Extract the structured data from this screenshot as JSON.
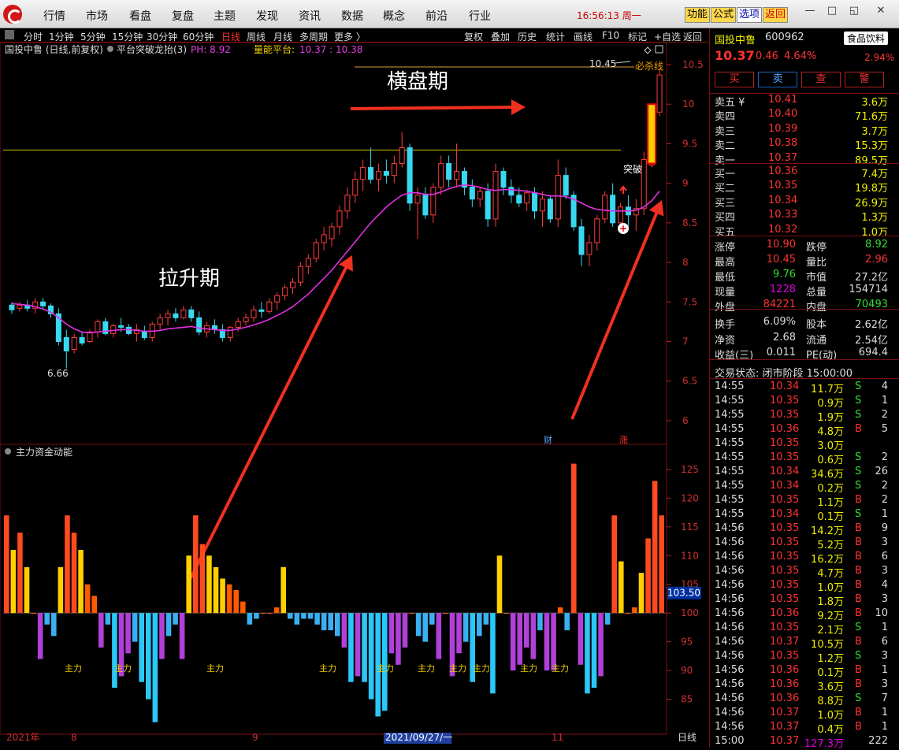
{
  "top_menu": [
    "行情",
    "市场",
    "看盘",
    "复盘",
    "主题",
    "发现",
    "资讯",
    "数据",
    "概念",
    "前沿",
    "行业"
  ],
  "clock": "16:56:13 周一",
  "top_buttons": [
    "功能",
    "公式",
    "选项",
    "返回"
  ],
  "period_tabs": [
    "分时",
    "1分钟",
    "5分钟",
    "15分钟",
    "30分钟",
    "60分钟",
    "日线",
    "周线",
    "月线",
    "多周期",
    "更多 〉"
  ],
  "tool_buttons": [
    "复权",
    "叠加",
    "历史",
    "统计",
    "画线",
    "F10",
    "标记",
    "+自选",
    "返回"
  ],
  "chart_header": {
    "name": "国投中鲁 (日线,前复权)",
    "indicator": "平台突破龙抬(3)",
    "ph": "PH: 8.92",
    "platform_label": "量能平台:",
    "platform_vals": "10.37 : 10.38"
  },
  "annotations": {
    "sideways": "横盘期",
    "rally": "拉升期",
    "breakout": "突破",
    "kill_line": "必杀线",
    "high_mark": "10.45",
    "low_mark": "6.66",
    "cai": "财",
    "zhang": "涨",
    "main_force": "主力"
  },
  "main_force_labels": [
    "主力",
    "主力",
    "主力",
    "主力",
    "主力",
    "主力",
    "主力",
    "主力",
    "主力",
    "主力"
  ],
  "sub_header": "主力资金动能",
  "sub_current": "103.50",
  "x_axis": [
    "2021年",
    "8",
    "9",
    "2021/09/27/一",
    "11",
    "日线"
  ],
  "chart_data": [
    {
      "type": "candlestick",
      "title": "国投中鲁 (日线,前复权)",
      "yaxis_ticks": [
        10.5,
        10.0,
        9.5,
        9.0,
        8.5,
        8.0,
        7.5,
        7.0,
        6.5,
        6.0
      ],
      "ylim": [
        5.7,
        10.6
      ],
      "platform_line": 9.42,
      "ph": 8.92,
      "high": 10.45,
      "low": 6.66,
      "ma_color": "#e030e0",
      "candles": [
        [
          7.46,
          7.5,
          7.35,
          7.4
        ],
        [
          7.42,
          7.5,
          7.38,
          7.46
        ],
        [
          7.46,
          7.52,
          7.38,
          7.42
        ],
        [
          7.42,
          7.55,
          7.35,
          7.5
        ],
        [
          7.5,
          7.55,
          7.4,
          7.45
        ],
        [
          7.45,
          7.48,
          7.3,
          7.35
        ],
        [
          7.35,
          7.42,
          6.95,
          7.0
        ],
        [
          7.05,
          7.15,
          6.66,
          6.88
        ],
        [
          6.9,
          7.1,
          6.85,
          7.05
        ],
        [
          7.05,
          7.12,
          6.95,
          6.98
        ],
        [
          7.0,
          7.15,
          6.98,
          7.12
        ],
        [
          7.12,
          7.28,
          7.05,
          7.25
        ],
        [
          7.25,
          7.3,
          7.08,
          7.1
        ],
        [
          7.1,
          7.22,
          7.05,
          7.2
        ],
        [
          7.2,
          7.3,
          7.12,
          7.18
        ],
        [
          7.18,
          7.22,
          7.08,
          7.1
        ],
        [
          7.1,
          7.22,
          7.0,
          7.15
        ],
        [
          7.12,
          7.2,
          7.02,
          7.05
        ],
        [
          7.05,
          7.25,
          7.0,
          7.22
        ],
        [
          7.22,
          7.35,
          7.15,
          7.3
        ],
        [
          7.3,
          7.4,
          7.2,
          7.35
        ],
        [
          7.35,
          7.42,
          7.25,
          7.3
        ],
        [
          7.3,
          7.45,
          7.28,
          7.4
        ],
        [
          7.4,
          7.45,
          7.25,
          7.3
        ],
        [
          7.3,
          7.38,
          7.08,
          7.12
        ],
        [
          7.12,
          7.25,
          7.05,
          7.2
        ],
        [
          7.2,
          7.28,
          7.1,
          7.15
        ],
        [
          7.15,
          7.22,
          7.0,
          7.05
        ],
        [
          7.05,
          7.2,
          7.0,
          7.18
        ],
        [
          7.18,
          7.3,
          7.12,
          7.25
        ],
        [
          7.25,
          7.35,
          7.2,
          7.3
        ],
        [
          7.3,
          7.45,
          7.25,
          7.4
        ],
        [
          7.4,
          7.5,
          7.3,
          7.38
        ],
        [
          7.38,
          7.55,
          7.35,
          7.5
        ],
        [
          7.5,
          7.62,
          7.4,
          7.58
        ],
        [
          7.58,
          7.72,
          7.52,
          7.68
        ],
        [
          7.68,
          7.8,
          7.6,
          7.75
        ],
        [
          7.75,
          8.0,
          7.7,
          7.95
        ],
        [
          7.95,
          8.1,
          7.85,
          8.05
        ],
        [
          8.05,
          8.3,
          8.0,
          8.25
        ],
        [
          8.25,
          8.45,
          8.15,
          8.35
        ],
        [
          8.3,
          8.5,
          8.2,
          8.45
        ],
        [
          8.45,
          8.72,
          8.35,
          8.65
        ],
        [
          8.65,
          8.95,
          8.55,
          8.85
        ],
        [
          8.85,
          9.15,
          8.75,
          9.05
        ],
        [
          9.05,
          9.3,
          8.9,
          9.2
        ],
        [
          9.2,
          9.45,
          9.0,
          9.05
        ],
        [
          9.05,
          9.25,
          8.9,
          9.15
        ],
        [
          9.15,
          9.3,
          9.0,
          9.1
        ],
        [
          9.1,
          9.35,
          9.0,
          9.25
        ],
        [
          9.25,
          9.65,
          9.2,
          9.45
        ],
        [
          9.45,
          9.5,
          8.65,
          8.75
        ],
        [
          8.75,
          8.95,
          8.3,
          8.85
        ],
        [
          8.85,
          8.95,
          8.55,
          8.6
        ],
        [
          8.6,
          9.0,
          8.5,
          8.95
        ],
        [
          8.95,
          9.35,
          8.85,
          9.25
        ],
        [
          9.25,
          9.35,
          8.95,
          9.05
        ],
        [
          9.05,
          9.5,
          8.95,
          9.15
        ],
        [
          9.15,
          9.2,
          8.85,
          8.95
        ],
        [
          8.95,
          9.05,
          8.7,
          8.8
        ],
        [
          8.8,
          8.95,
          8.7,
          8.9
        ],
        [
          8.9,
          9.0,
          8.45,
          8.55
        ],
        [
          8.55,
          9.25,
          8.45,
          9.15
        ],
        [
          9.15,
          9.2,
          8.85,
          8.95
        ],
        [
          8.95,
          9.05,
          8.75,
          8.85
        ],
        [
          8.85,
          8.95,
          8.7,
          8.75
        ],
        [
          8.75,
          8.92,
          8.65,
          8.88
        ],
        [
          8.88,
          8.95,
          8.55,
          8.65
        ],
        [
          8.65,
          8.9,
          8.45,
          8.8
        ],
        [
          8.8,
          8.85,
          8.5,
          8.55
        ],
        [
          8.55,
          9.3,
          8.45,
          9.1
        ],
        [
          9.1,
          9.2,
          8.8,
          8.85
        ],
        [
          8.85,
          8.9,
          8.4,
          8.45
        ],
        [
          8.45,
          8.55,
          7.95,
          8.1
        ],
        [
          8.1,
          8.35,
          7.95,
          8.25
        ],
        [
          8.25,
          8.6,
          8.15,
          8.55
        ],
        [
          8.55,
          8.9,
          8.5,
          8.85
        ],
        [
          8.85,
          9.0,
          8.45,
          8.5
        ],
        [
          8.5,
          8.75,
          8.4,
          8.7
        ],
        [
          8.7,
          8.85,
          8.45,
          8.6
        ],
        [
          8.6,
          8.8,
          8.4,
          8.68
        ],
        [
          8.68,
          9.4,
          8.6,
          9.3
        ],
        [
          9.23,
          10.0,
          9.2,
          9.9
        ],
        [
          9.9,
          10.45,
          9.85,
          10.37
        ]
      ],
      "ma": [
        7.48,
        7.47,
        7.46,
        7.44,
        7.41,
        7.37,
        7.3,
        7.22,
        7.16,
        7.12,
        7.11,
        7.12,
        7.13,
        7.14,
        7.15,
        7.15,
        7.14,
        7.13,
        7.13,
        7.14,
        7.16,
        7.17,
        7.18,
        7.19,
        7.17,
        7.16,
        7.15,
        7.14,
        7.14,
        7.16,
        7.18,
        7.21,
        7.24,
        7.28,
        7.33,
        7.38,
        7.44,
        7.52,
        7.6,
        7.7,
        7.8,
        7.9,
        8.02,
        8.14,
        8.26,
        8.38,
        8.5,
        8.6,
        8.7,
        8.78,
        8.85,
        8.88,
        8.88,
        8.86,
        8.86,
        8.89,
        8.93,
        8.96,
        8.98,
        8.97,
        8.95,
        8.92,
        8.91,
        8.92,
        8.92,
        8.91,
        8.9,
        8.88,
        8.86,
        8.84,
        8.84,
        8.83,
        8.8,
        8.75,
        8.7,
        8.67,
        8.66,
        8.65,
        8.65,
        8.65,
        8.66,
        8.7,
        8.78,
        8.9
      ]
    },
    {
      "type": "bar",
      "title": "主力资金动能",
      "yaxis_ticks": [
        125.0,
        120.0,
        115.0,
        110.0,
        105.0,
        100.0,
        95.0,
        90.0,
        85.0
      ],
      "ylim": [
        80,
        128
      ],
      "baseline": 100,
      "current": 103.5,
      "values": [
        117,
        111,
        114,
        108,
        100,
        92,
        98,
        96,
        108,
        117,
        114,
        111,
        105,
        103,
        94,
        98,
        87,
        89,
        93,
        95,
        88,
        85,
        81,
        92,
        96,
        98,
        92,
        110,
        117,
        112,
        110,
        108,
        106,
        105,
        104,
        102,
        98,
        99,
        100,
        100,
        101,
        108,
        99,
        98,
        99,
        99,
        98,
        97,
        97,
        96,
        94,
        88,
        89,
        88,
        85,
        82,
        83,
        93,
        91,
        94,
        100,
        96,
        95,
        98,
        92,
        100,
        89,
        93,
        95,
        88,
        96,
        98,
        86,
        110,
        100,
        90,
        91,
        94,
        92,
        97,
        90,
        90,
        101,
        97,
        126,
        91,
        86,
        87,
        89,
        98,
        117,
        109,
        100,
        101,
        107,
        113,
        123,
        117
      ]
    }
  ],
  "stock": {
    "name": "国投中鲁",
    "code": "600962",
    "sector": "食品饮料",
    "price": "10.37",
    "change": "0.46",
    "pct": "4.64%",
    "sector_pct": "2.94%"
  },
  "trade_buttons": [
    "买",
    "卖",
    "查",
    "警"
  ],
  "asks": [
    {
      "label": "卖五 ¥",
      "price": "10.41",
      "vol": "3.6万"
    },
    {
      "label": "卖四",
      "price": "10.40",
      "vol": "71.6万"
    },
    {
      "label": "卖三",
      "price": "10.39",
      "vol": "3.7万"
    },
    {
      "label": "卖二",
      "price": "10.38",
      "vol": "15.3万"
    },
    {
      "label": "卖一",
      "price": "10.37",
      "vol": "89.5万"
    }
  ],
  "bids": [
    {
      "label": "买一",
      "price": "10.36",
      "vol": "7.4万"
    },
    {
      "label": "买二",
      "price": "10.35",
      "vol": "19.8万"
    },
    {
      "label": "买三",
      "price": "10.34",
      "vol": "26.9万"
    },
    {
      "label": "买四",
      "price": "10.33",
      "vol": "1.3万"
    },
    {
      "label": "买五",
      "price": "10.32",
      "vol": "1.0万"
    }
  ],
  "stats": [
    {
      "l1": "涨停",
      "v1": "10.90",
      "c1": "red",
      "l2": "跌停",
      "v2": "8.92",
      "c2": "grn"
    },
    {
      "l1": "最高",
      "v1": "10.45",
      "c1": "red",
      "l2": "量比",
      "v2": "2.96",
      "c2": "red"
    },
    {
      "l1": "最低",
      "v1": "9.76",
      "c1": "grn",
      "l2": "市值",
      "v2": "27.2亿",
      "c2": "wht"
    },
    {
      "l1": "现量",
      "v1": "1228",
      "c1": "mag",
      "l2": "总量",
      "v2": "154714",
      "c2": "wht"
    },
    {
      "l1": "外盘",
      "v1": "84221",
      "c1": "red",
      "l2": "内盘",
      "v2": "70493",
      "c2": "grn"
    },
    {
      "l1": "换手",
      "v1": "6.09%",
      "c1": "wht",
      "l2": "股本",
      "v2": "2.62亿",
      "c2": "wht"
    },
    {
      "l1": "净资",
      "v1": "2.68",
      "c1": "wht",
      "l2": "流通",
      "v2": "2.54亿",
      "c2": "wht"
    },
    {
      "l1": "收益(三)",
      "v1": "0.011",
      "c1": "wht",
      "l2": "PE(动)",
      "v2": "694.4",
      "c2": "wht"
    }
  ],
  "trade_status": "交易状态: 闭市阶段 15:00:00",
  "ticks": [
    [
      "14:55",
      "10.34",
      "11.7万",
      "S",
      "4"
    ],
    [
      "14:55",
      "10.35",
      "0.9万",
      "S",
      "1"
    ],
    [
      "14:55",
      "10.35",
      "1.9万",
      "S",
      "2"
    ],
    [
      "14:55",
      "10.36",
      "4.8万",
      "B",
      "5"
    ],
    [
      "14:55",
      "10.35",
      "3.0万",
      "",
      ""
    ],
    [
      "14:55",
      "10.35",
      "0.6万",
      "S",
      "2"
    ],
    [
      "14:55",
      "10.34",
      "34.6万",
      "S",
      "26"
    ],
    [
      "14:55",
      "10.34",
      "0.2万",
      "S",
      "2"
    ],
    [
      "14:55",
      "10.35",
      "1.1万",
      "B",
      "2"
    ],
    [
      "14:55",
      "10.34",
      "0.1万",
      "S",
      "1"
    ],
    [
      "14:56",
      "10.35",
      "14.2万",
      "B",
      "9"
    ],
    [
      "14:56",
      "10.35",
      "5.2万",
      "B",
      "3"
    ],
    [
      "14:56",
      "10.35",
      "16.2万",
      "B",
      "6"
    ],
    [
      "14:56",
      "10.35",
      "4.7万",
      "B",
      "3"
    ],
    [
      "14:56",
      "10.35",
      "1.0万",
      "B",
      "4"
    ],
    [
      "14:56",
      "10.35",
      "1.8万",
      "B",
      "3"
    ],
    [
      "14:56",
      "10.36",
      "9.2万",
      "B",
      "10"
    ],
    [
      "14:56",
      "10.35",
      "2.1万",
      "S",
      "1"
    ],
    [
      "14:56",
      "10.37",
      "10.5万",
      "B",
      "6"
    ],
    [
      "14:56",
      "10.35",
      "1.2万",
      "S",
      "3"
    ],
    [
      "14:56",
      "10.36",
      "0.1万",
      "B",
      "1"
    ],
    [
      "14:56",
      "10.36",
      "3.6万",
      "B",
      "3"
    ],
    [
      "14:56",
      "10.36",
      "8.8万",
      "S",
      "7"
    ],
    [
      "14:56",
      "10.37",
      "1.0万",
      "B",
      "1"
    ],
    [
      "14:56",
      "10.37",
      "0.4万",
      "B",
      "1"
    ],
    [
      "15:00",
      "10.37",
      "127.3万",
      "",
      "222"
    ]
  ]
}
